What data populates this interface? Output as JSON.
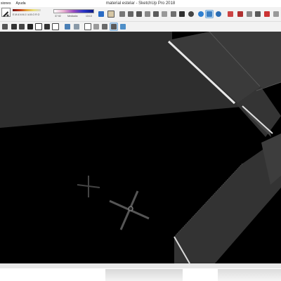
{
  "window": {
    "title": "material estelar - SketchUp Pro 2018"
  },
  "menu": {
    "items": [
      "siones",
      "Ayuda"
    ]
  },
  "toolbar": {
    "styles_letters": "E M A N M J I A B O R O",
    "gradient_left_value": "37.92",
    "gradient_label": "Mediodía",
    "gradient_right_value": "13:13",
    "top_icons": [
      "bar-chart-icon",
      "list-icon",
      "box-icon",
      "box-icon",
      "box-icon",
      "box-icon",
      "box-icon",
      "box-icon",
      "window-icon",
      "section-icon",
      "eye-icon",
      "eye-icon",
      "plug-icon",
      "rotate-icon",
      "orbit-icon",
      "compass-icon",
      "walk-icon",
      "push-pull-icon",
      "move-icon",
      "rotate3d-icon",
      "scale-icon",
      "offset-icon",
      "layer-icon"
    ],
    "second_row_icons": [
      "paint-icon",
      "tape-icon",
      "protractor-icon",
      "text-icon",
      "home-icon",
      "house-outline-icon",
      "house-icon",
      "box-icon",
      "cube-blue-icon",
      "cube-gray-icon",
      "cube-outline-icon",
      "cube-shaded-icon",
      "cube-dark-icon",
      "layers-icon",
      "cube-selected-icon"
    ]
  },
  "colors": {
    "viewport_bg": "#000000",
    "plane_gray": "#2e2e2e",
    "wall_gray": "#3a3a3a",
    "accent_blue": "#1f6fc0"
  }
}
